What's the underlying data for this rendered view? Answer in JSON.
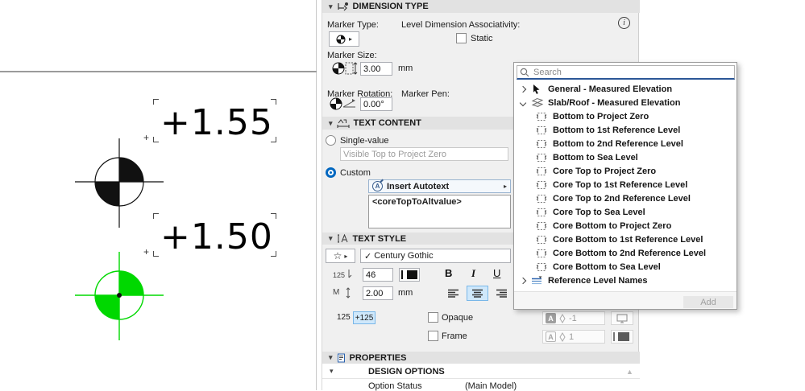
{
  "colors": {
    "toggle_bg": "#cfe8fb",
    "toggle_border": "#79b7e8",
    "radio_blue": "#0067c0",
    "search_underline": "#2b5797",
    "marker_green": "#00d800",
    "marker_black": "#111111"
  },
  "icons": {
    "collapse": "▾",
    "arrow_right": "▸",
    "check": "✓",
    "star": "☆",
    "info": "i",
    "scroll_up": "▲",
    "plus_handle": "+"
  },
  "canvas": {
    "dim1_text": "+1.55",
    "dim2_text": "+1.50"
  },
  "panel": {
    "dimension_type": {
      "title": "DIMENSION TYPE",
      "marker_type_label": "Marker Type:",
      "assoc_label": "Level Dimension Associativity:",
      "static_label": "Static",
      "marker_size_label": "Marker Size:",
      "marker_size_value": "3.00",
      "marker_size_unit": "mm",
      "marker_rotation_label": "Marker Rotation:",
      "marker_rotation_value": "0.00°",
      "marker_pen_label": "Marker Pen:"
    },
    "text_content": {
      "title": "TEXT CONTENT",
      "single_value_label": "Single-value",
      "single_value_text": "Visible Top to Project Zero",
      "custom_label": "Custom",
      "autotext_icon_letter": "A",
      "insert_autotext_label": "Insert Autotext",
      "custom_text": "<coreTopToAltvalue>"
    },
    "text_style": {
      "title": "TEXT STYLE",
      "font_name": "Century Gothic",
      "size_icon": "125",
      "size_value": "46",
      "bold": "B",
      "italic": "I",
      "underline": "U",
      "height_icon": "M",
      "height_value": "2.00",
      "height_unit": "mm",
      "sup_off": "125",
      "sup_on": "+125",
      "opaque_label": "Opaque",
      "frame_label": "Frame",
      "pen_letter": "A",
      "pen1_value": "-1",
      "pen2_value": "1"
    },
    "properties": {
      "title": "PROPERTIES",
      "group_title": "DESIGN OPTIONS",
      "row_label": "Option Status",
      "row_value": "(Main Model)"
    }
  },
  "dropdown": {
    "search_placeholder": "Search",
    "add_label": "Add",
    "items": [
      {
        "kind": "group",
        "icon": "cursor",
        "state": "collapsed",
        "label": "General - Measured Elevation"
      },
      {
        "kind": "group",
        "icon": "slab",
        "state": "expanded",
        "label": "Slab/Roof - Measured Elevation"
      },
      {
        "kind": "item",
        "icon": "dim",
        "label": "Bottom to Project Zero"
      },
      {
        "kind": "item",
        "icon": "dim",
        "label": "Bottom to 1st Reference Level"
      },
      {
        "kind": "item",
        "icon": "dim",
        "label": "Bottom to 2nd Reference Level"
      },
      {
        "kind": "item",
        "icon": "dim",
        "label": "Bottom to Sea Level"
      },
      {
        "kind": "item",
        "icon": "dim",
        "label": "Core Top to Project Zero"
      },
      {
        "kind": "item",
        "icon": "dim",
        "label": "Core Top to 1st Reference Level"
      },
      {
        "kind": "item",
        "icon": "dim",
        "label": "Core Top to 2nd Reference Level"
      },
      {
        "kind": "item",
        "icon": "dim",
        "label": "Core Top to Sea Level"
      },
      {
        "kind": "item",
        "icon": "dim",
        "label": "Core Bottom to Project Zero"
      },
      {
        "kind": "item",
        "icon": "dim",
        "label": "Core Bottom to 1st Reference Level"
      },
      {
        "kind": "item",
        "icon": "dim",
        "label": "Core Bottom to 2nd Reference Level"
      },
      {
        "kind": "item",
        "icon": "dim",
        "label": "Core Bottom to Sea Level"
      },
      {
        "kind": "group",
        "icon": "levels",
        "state": "collapsed",
        "label": "Reference Level Names"
      }
    ]
  }
}
